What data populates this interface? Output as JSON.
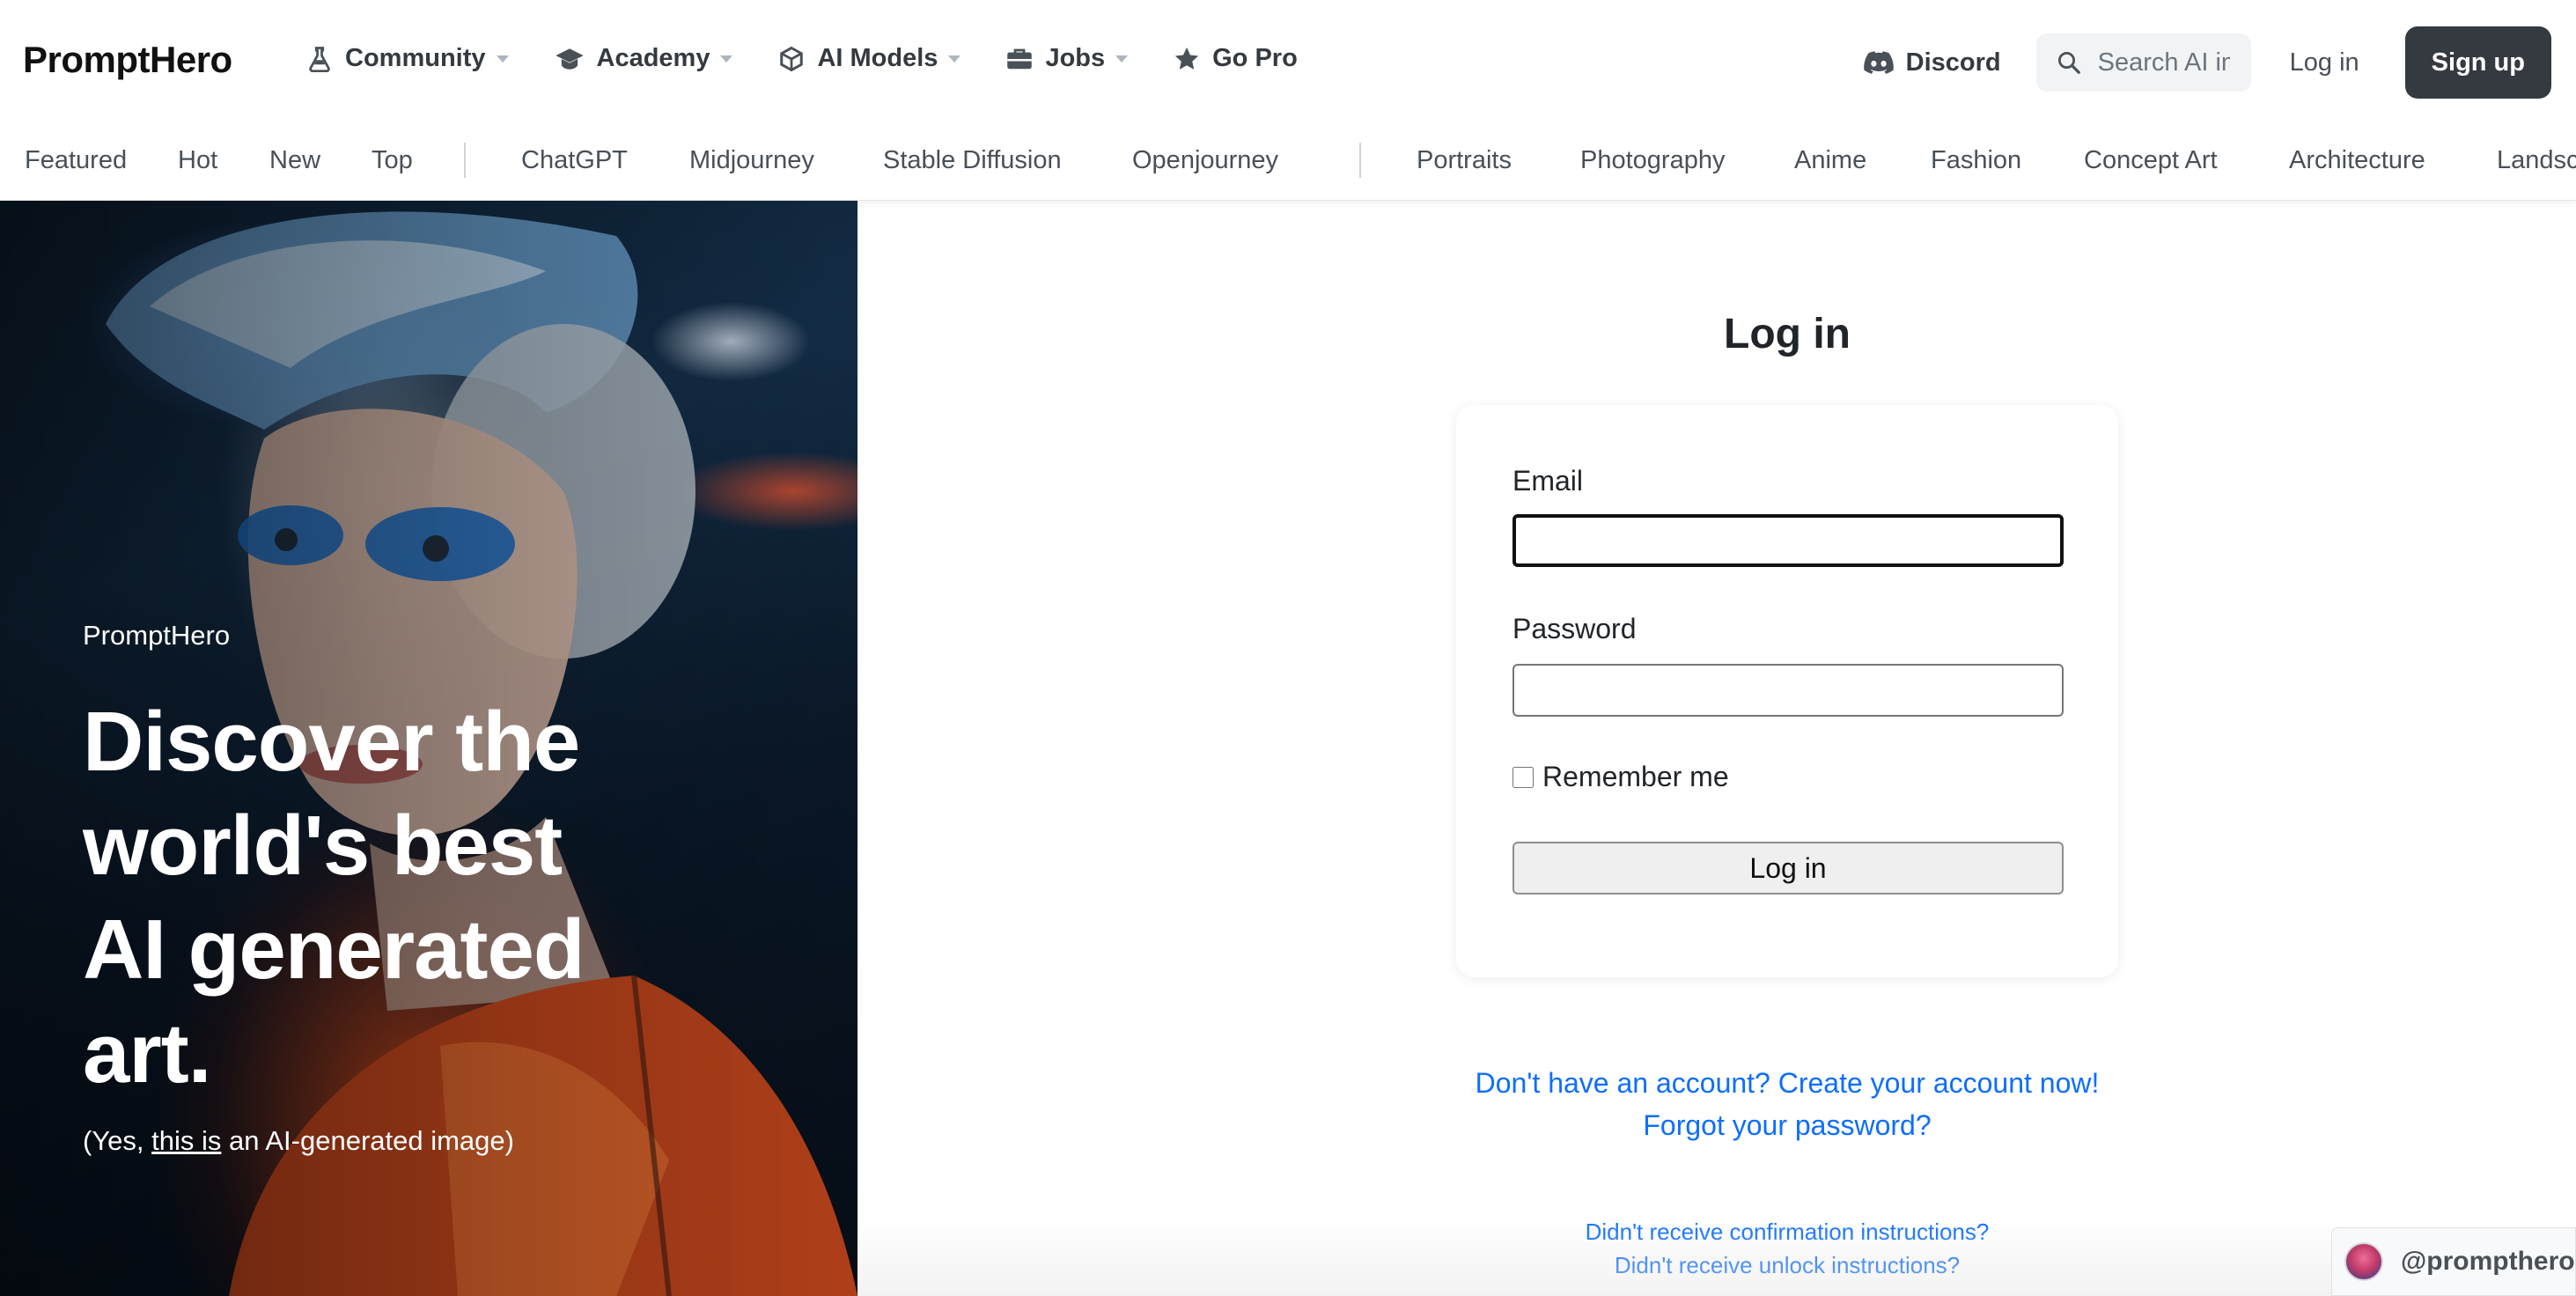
{
  "brand": "PromptHero",
  "nav": {
    "items": [
      {
        "label": "Community",
        "icon": "flask-icon",
        "has_caret": true
      },
      {
        "label": "Academy",
        "icon": "graduation-cap-icon",
        "has_caret": true
      },
      {
        "label": "AI Models",
        "icon": "cube-icon",
        "has_caret": true
      },
      {
        "label": "Jobs",
        "icon": "briefcase-icon",
        "has_caret": true
      },
      {
        "label": "Go Pro",
        "icon": "star-icon",
        "has_caret": false
      }
    ],
    "discord_label": "Discord",
    "search_placeholder": "Search AI images...",
    "login_label": "Log in",
    "signup_label": "Sign up"
  },
  "categories": {
    "sort": [
      "Featured",
      "Hot",
      "New",
      "Top"
    ],
    "models": [
      "ChatGPT",
      "Midjourney",
      "Stable Diffusion",
      "Openjourney"
    ],
    "topics": [
      "Portraits",
      "Photography",
      "Anime",
      "Fashion",
      "Concept Art",
      "Architecture",
      "Landscapes"
    ]
  },
  "hero": {
    "brand": "PromptHero",
    "title": "Discover the world's best AI generated art.",
    "caption_prefix": "(Yes, ",
    "caption_link": "this is",
    "caption_suffix": " an AI-generated image)"
  },
  "login": {
    "title": "Log in",
    "email_label": "Email",
    "email_value": "",
    "password_label": "Password",
    "password_value": "",
    "remember_label": "Remember me",
    "remember_checked": false,
    "submit_label": "Log in"
  },
  "links": {
    "create_account": "Don't have an account? Create your account now!",
    "forgot_password": "Forgot your password?",
    "confirmation": "Didn't receive confirmation instructions?",
    "unlock": "Didn't receive unlock instructions?"
  },
  "handle": "@prompthero",
  "colors": {
    "link": "#0d6efd",
    "signup_bg": "#343a40",
    "hero_accent": "#c8461c"
  }
}
